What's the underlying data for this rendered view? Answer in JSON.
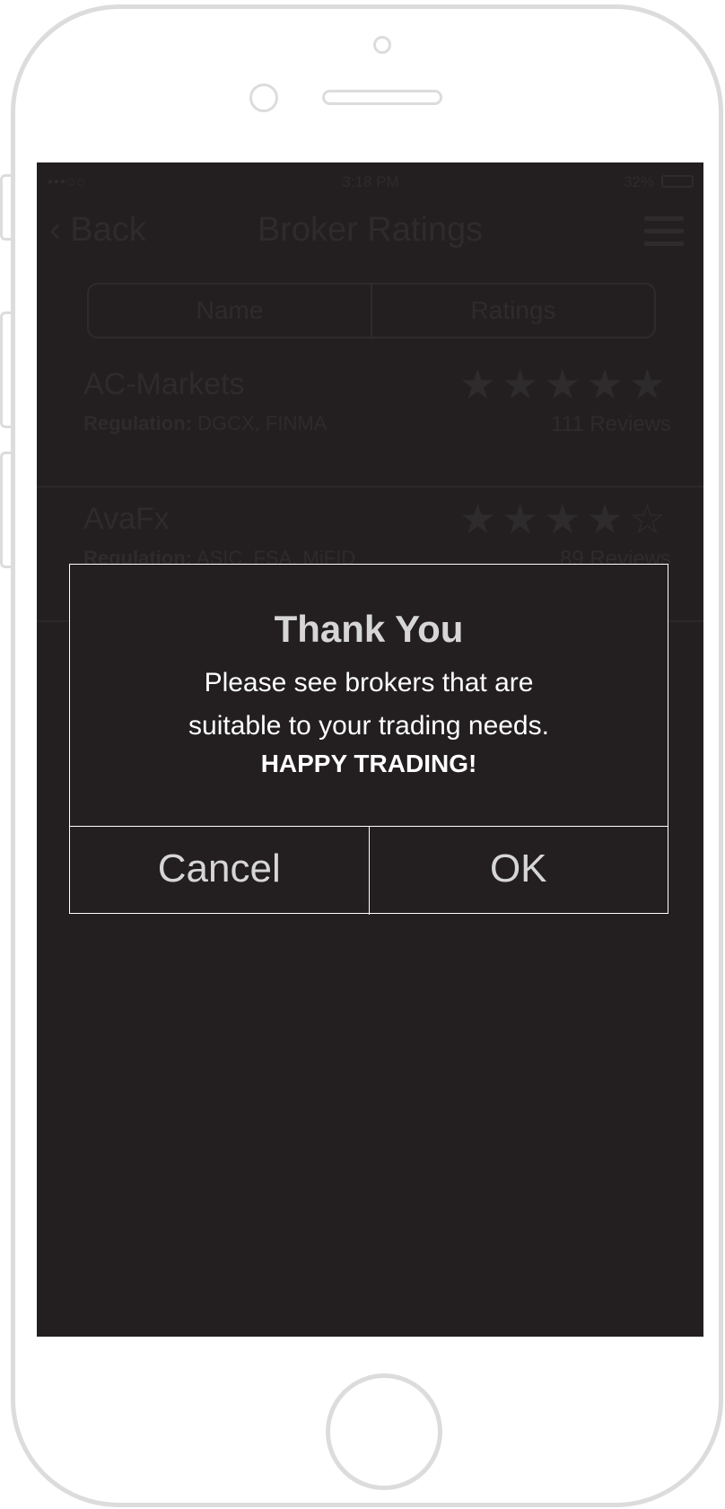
{
  "status_bar": {
    "carrier": "•••○○",
    "time": "3:18 PM",
    "battery": "32%"
  },
  "nav": {
    "back_label": "‹ Back",
    "title": "Broker Ratings"
  },
  "segments": [
    "Name",
    "Ratings"
  ],
  "brokers": [
    {
      "name": "AC-Markets",
      "regulation_label": "Regulation:",
      "regulation": "DGCX, FINMA",
      "stars": "★★★★★",
      "reviews": "111 Reviews"
    },
    {
      "name": "AvaFx",
      "regulation_label": "Regulation:",
      "regulation": "ASIC, FSA, MiFID",
      "stars": "★★★★☆",
      "reviews": "89 Reviews"
    }
  ],
  "dialog": {
    "title": "Thank You",
    "message_line1": "Please see brokers that are",
    "message_line2": "suitable to your trading needs.",
    "emphasis": "HAPPY TRADING!",
    "cancel_label": "Cancel",
    "ok_label": "OK"
  }
}
